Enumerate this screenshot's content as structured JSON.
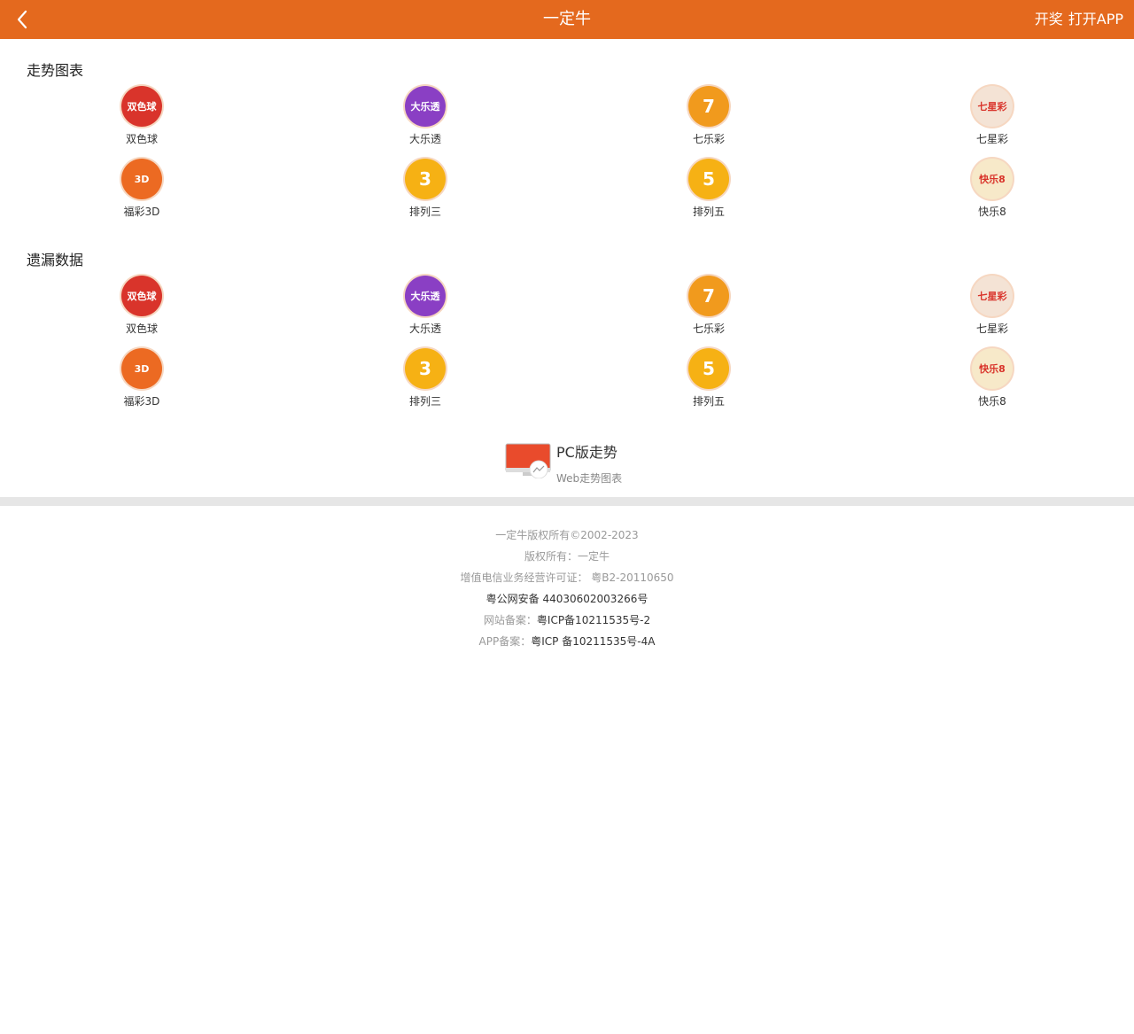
{
  "header": {
    "back_label": "‹",
    "title": "一定牛",
    "right_items": [
      "开奖",
      "打开APP"
    ],
    "bg_color": "#e4691e"
  },
  "sections": [
    {
      "title": "走势图表",
      "items": [
        {
          "label": "双色球",
          "icon": "shuangseqiu-logo",
          "color": "#d9342b",
          "logo_text": "双色球"
        },
        {
          "label": "大乐透",
          "icon": "daletou-logo",
          "color": "#8a3fc4",
          "logo_text": "大乐透"
        },
        {
          "label": "七乐彩",
          "icon": "qilecai-logo",
          "color": "#f19a1d",
          "logo_text": "7"
        },
        {
          "label": "七星彩",
          "icon": "qixingcai-logo",
          "color": "#f4e3d5",
          "logo_text": "七星彩"
        },
        {
          "label": "福彩3D",
          "icon": "fucai3d-logo",
          "color": "#ec6a22",
          "logo_text": "3D"
        },
        {
          "label": "排列三",
          "icon": "pailiesan-logo",
          "color": "#f6b114",
          "logo_text": "3"
        },
        {
          "label": "排列五",
          "icon": "pailiewu-logo",
          "color": "#f6b114",
          "logo_text": "5"
        },
        {
          "label": "快乐8",
          "icon": "kuaile8-logo",
          "color": "#f7e9c9",
          "logo_text": "快乐8"
        }
      ]
    },
    {
      "title": "遗漏数据",
      "items": [
        {
          "label": "双色球",
          "icon": "shuangseqiu-logo",
          "color": "#d9342b",
          "logo_text": "双色球"
        },
        {
          "label": "大乐透",
          "icon": "daletou-logo",
          "color": "#8a3fc4",
          "logo_text": "大乐透"
        },
        {
          "label": "七乐彩",
          "icon": "qilecai-logo",
          "color": "#f19a1d",
          "logo_text": "7"
        },
        {
          "label": "七星彩",
          "icon": "qixingcai-logo",
          "color": "#f4e3d5",
          "logo_text": "七星彩"
        },
        {
          "label": "福彩3D",
          "icon": "fucai3d-logo",
          "color": "#ec6a22",
          "logo_text": "3D"
        },
        {
          "label": "排列三",
          "icon": "pailiesan-logo",
          "color": "#f6b114",
          "logo_text": "3"
        },
        {
          "label": "排列五",
          "icon": "pailiewu-logo",
          "color": "#f6b114",
          "logo_text": "5"
        },
        {
          "label": "快乐8",
          "icon": "kuaile8-logo",
          "color": "#f7e9c9",
          "logo_text": "快乐8"
        }
      ]
    }
  ],
  "pc_link": {
    "title": "PC版走势",
    "subtitle": "Web走势图表",
    "icon": "monitor-chart-icon"
  },
  "footer": {
    "lines": [
      {
        "text": "一定牛版权所有©2002-2023",
        "dark": false
      },
      {
        "text": "版权所有：一定牛",
        "dark": false
      },
      {
        "text": "增值电信业务经营许可证： 粤B2-20110650",
        "dark": false
      },
      {
        "text": "粤公网安备 44030602003266号",
        "dark": true
      },
      {
        "label": "网站备案：",
        "value": "粤ICP备10211535号-2"
      },
      {
        "label": "APP备案：",
        "value": "粤ICP 备10211535号-4A"
      }
    ]
  }
}
